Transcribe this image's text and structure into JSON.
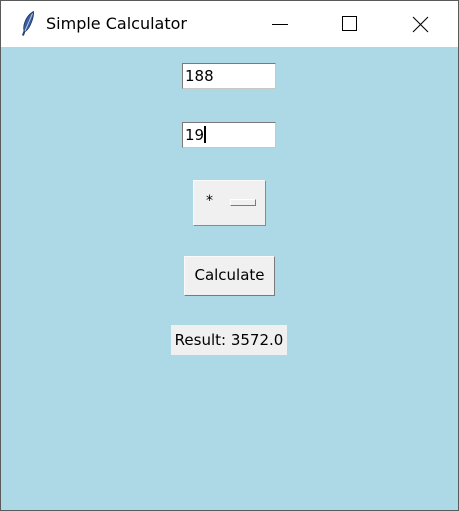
{
  "window": {
    "title": "Simple Calculator",
    "app_icon": "feather-icon",
    "controls": {
      "minimize_icon": "minimize-icon",
      "maximize_icon": "maximize-icon",
      "close_icon": "close-icon"
    }
  },
  "form": {
    "first_number": "188",
    "second_number": "19",
    "operator": "*",
    "calculate_label": "Calculate",
    "result_text": "Result: 3572.0"
  },
  "colors": {
    "background": "#add8e6",
    "widget": "#f0f0f0",
    "entry": "#ffffff"
  }
}
